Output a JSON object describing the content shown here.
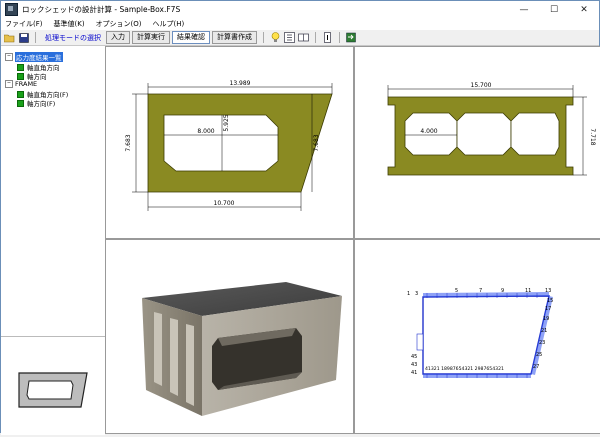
{
  "window": {
    "title": "ロックシェッドの設計計算 - Sample-Box.F7S",
    "minimize": "—",
    "maximize": "☐",
    "close": "✕"
  },
  "menu": [
    "ファイル(F)",
    "基準値(K)",
    "オプション(O)",
    "ヘルプ(H)"
  ],
  "toolbar": {
    "mode_label": "処理モードの選択",
    "tabs": [
      {
        "label": "入力",
        "active": false
      },
      {
        "label": "計算実行",
        "active": false
      },
      {
        "label": "結果確認",
        "active": true
      },
      {
        "label": "計算書作成",
        "active": false
      }
    ]
  },
  "tree": {
    "items": [
      {
        "label": "応力度結果一覧",
        "selected": true
      },
      {
        "label": "軸直角方向"
      },
      {
        "label": "軸方向"
      },
      {
        "label": "FRAME"
      },
      {
        "label": "軸直角方向(F)"
      },
      {
        "label": "軸方向(F)"
      }
    ]
  },
  "views": {
    "front": {
      "top_width": "13.989",
      "inner_width": "8.000",
      "inner_height": "5.925",
      "left_height": "7.683",
      "right_height": "7.683",
      "bottom_width": "10.700",
      "fill_color": "#8a8a22"
    },
    "side": {
      "total_width": "15.700",
      "span": "4.000",
      "height": "7.718",
      "fill_color": "#8a8a22"
    },
    "frame": {
      "node_labels_top": [
        "1",
        "3",
        "5",
        "7",
        "9",
        "11",
        "13"
      ],
      "left_labels": [
        "45",
        "43",
        "41"
      ],
      "right_labels": [
        "15",
        "17",
        "19",
        "21",
        "23",
        "25",
        "27"
      ],
      "bottom_row": "41321 18987654321 2987654321",
      "member_color": "#2233cc",
      "load_color": "#3355ee"
    }
  }
}
